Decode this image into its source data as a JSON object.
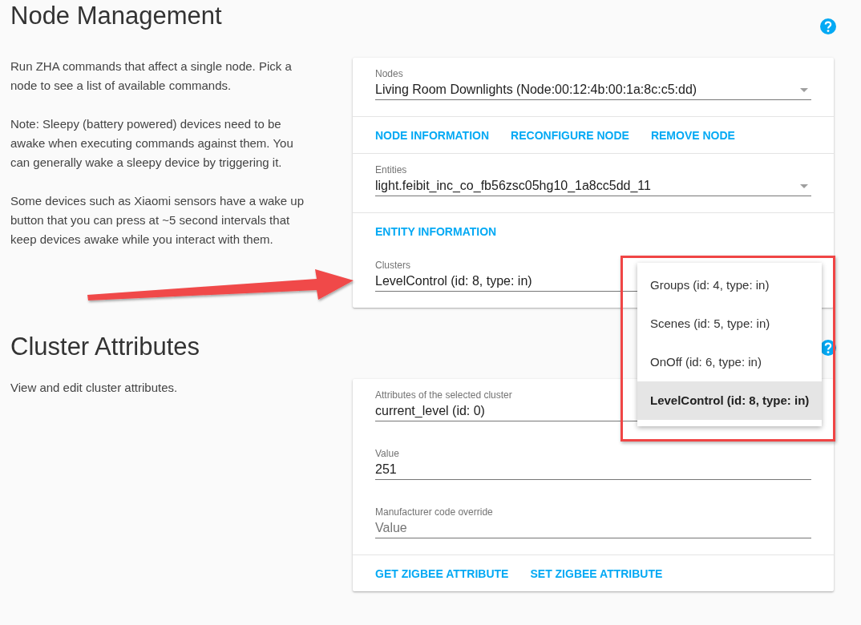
{
  "sections": [
    {
      "title": "Node Management",
      "description": [
        "Run ZHA commands that affect a single node. Pick a node to see a list of available commands.",
        "Note: Sleepy (battery powered) devices need to be awake when executing commands against them. You can generally wake a sleepy device by triggering it.",
        "Some devices such as Xiaomi sensors have a wake up button that you can press at ~5 second intervals that keep devices awake while you interact with them."
      ],
      "blocks": [
        {
          "kind": "select",
          "label": "Nodes",
          "value": "Living Room Downlights (Node:00:12:4b:00:1a:8c:c5:dd)"
        },
        {
          "kind": "actions",
          "buttons": [
            "NODE INFORMATION",
            "RECONFIGURE NODE",
            "REMOVE NODE"
          ]
        },
        {
          "kind": "divider"
        },
        {
          "kind": "select",
          "label": "Entities",
          "value": "light.feibit_inc_co_fb56zsc05hg10_1a8cc5dd_11"
        },
        {
          "kind": "actions",
          "buttons": [
            "ENTITY INFORMATION"
          ]
        },
        {
          "kind": "select",
          "label": "Clusters",
          "value": "LevelControl (id: 8, type: in)"
        }
      ]
    },
    {
      "title": "Cluster Attributes",
      "description": [
        "View and edit cluster attributes."
      ],
      "blocks": [
        {
          "kind": "select",
          "label": "Attributes of the selected cluster",
          "value": "current_level (id: 0)"
        },
        {
          "kind": "input",
          "label": "Value",
          "value": "251"
        },
        {
          "kind": "input",
          "label": "Manufacturer code override",
          "placeholder": "Value"
        },
        {
          "kind": "actions",
          "buttons": [
            "GET ZIGBEE ATTRIBUTE",
            "SET ZIGBEE ATTRIBUTE"
          ]
        }
      ]
    }
  ],
  "cluster_menu": {
    "items": [
      {
        "label": "Groups (id: 4, type: in)",
        "selected": false
      },
      {
        "label": "Scenes (id: 5, type: in)",
        "selected": false
      },
      {
        "label": "OnOff (id: 6, type: in)",
        "selected": false
      },
      {
        "label": "LevelControl (id: 8, type: in)",
        "selected": true
      }
    ]
  }
}
